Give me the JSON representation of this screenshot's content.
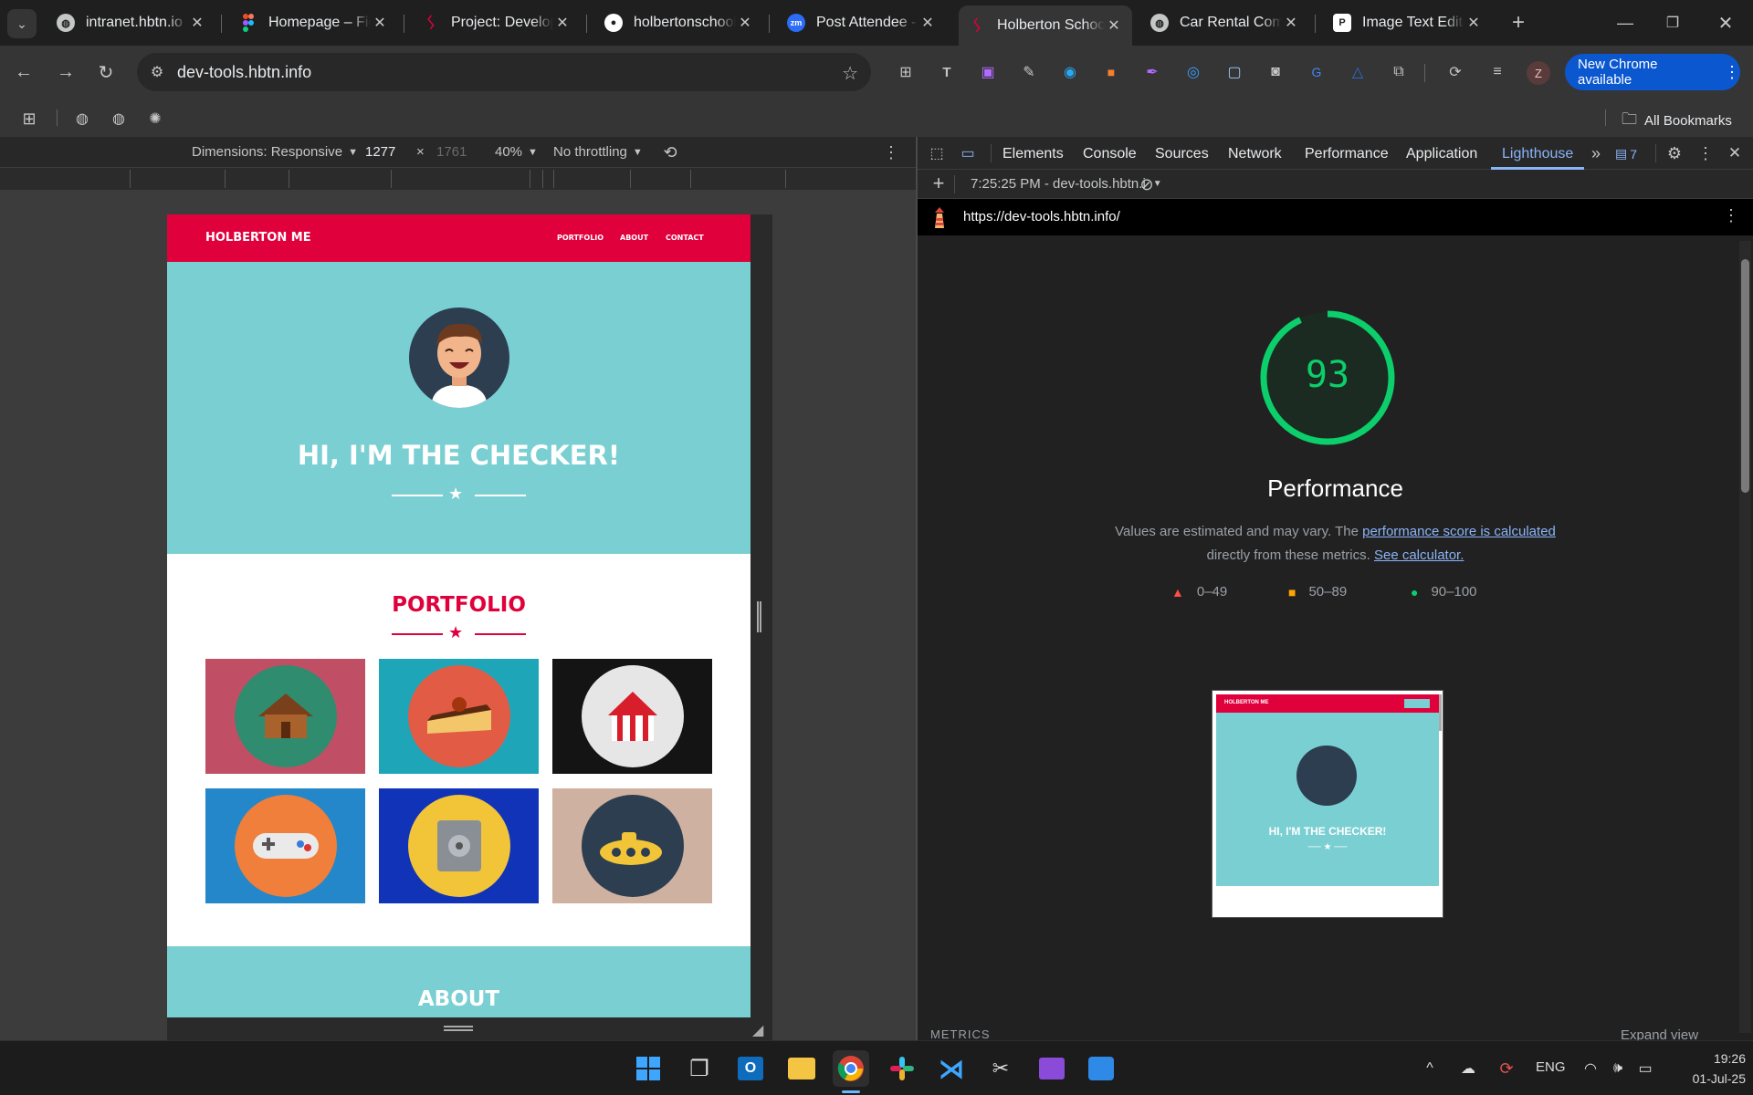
{
  "browser": {
    "tabs": [
      {
        "title": "intranet.hbtn.io",
        "favicon": "globe-icon"
      },
      {
        "title": "Homepage – Figma",
        "favicon": "figma-icon"
      },
      {
        "title": "Project: Developer",
        "favicon": "holberton-icon"
      },
      {
        "title": "holbertonschool",
        "favicon": "github-icon"
      },
      {
        "title": "Post Attendee - Zoom",
        "favicon": "zoom-icon"
      },
      {
        "title": "Holberton School",
        "favicon": "holberton-icon",
        "active": true
      },
      {
        "title": "Car Rental Company",
        "favicon": "globe-icon"
      },
      {
        "title": "Image Text Editor",
        "favicon": "editor-icon"
      }
    ],
    "url": "dev-tools.hbtn.info",
    "profile_initial": "Z",
    "update_button": "New Chrome available",
    "all_bookmarks": "All Bookmarks"
  },
  "device_toolbar": {
    "dimensions": "Dimensions: Responsive",
    "width": "1277",
    "times": "×",
    "height": "1761",
    "zoom": "40%",
    "throttling": "No throttling"
  },
  "page": {
    "brand": "HOLBERTON ME",
    "nav": [
      "PORTFOLIO",
      "ABOUT",
      "CONTACT"
    ],
    "hero_title": "HI, I'M THE CHECKER!",
    "portfolio_title": "PORTFOLIO",
    "about_title": "ABOUT",
    "colors": {
      "brand_red": "#e0003c",
      "hero_teal": "#7acfd2"
    }
  },
  "devtools": {
    "tabs": [
      "Elements",
      "Console",
      "Sources",
      "Network",
      "Performance",
      "Application",
      "Lighthouse"
    ],
    "active_tab": "Lighthouse",
    "issues_count": "7",
    "report_selector": "7:25:25 PM - dev-tools.hbtn.i",
    "report_url": "https://dev-tools.hbtn.info/"
  },
  "lighthouse": {
    "score": "93",
    "category": "Performance",
    "desc_prefix": "Values are estimated and may vary. The",
    "desc_link": "performance score is calculated",
    "desc_middle": "directly from these metrics.",
    "desc_link2": "See calculator.",
    "legend": [
      "0–49",
      "50–89",
      "90–100"
    ],
    "thumb_brand": "HOLBERTON ME",
    "thumb_title": "HI, I'M THE CHECKER!",
    "metrics_label": "METRICS",
    "expand_view": "Expand view",
    "score_color": "#0cce6b"
  },
  "taskbar": {
    "lang": "ENG",
    "time": "19:26",
    "date": "01-Jul-25"
  }
}
